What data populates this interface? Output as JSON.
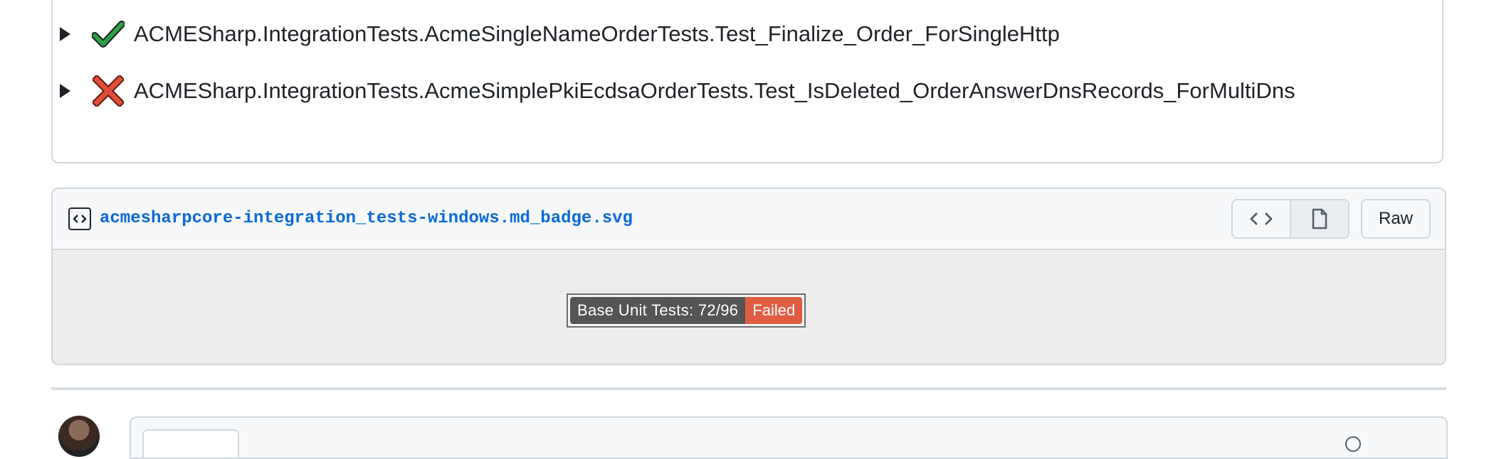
{
  "tests": [
    {
      "status": "passed",
      "name": "ACMESharp.IntegrationTests.AcmeSingleNameOrderTests.Test_Finalize_Order_ForSingleHttp"
    },
    {
      "status": "failed",
      "name": "ACMESharp.IntegrationTests.AcmeSimplePkiEcdsaOrderTests.Test_IsDeleted_OrderAnswerDnsRecords_ForMultiDns"
    }
  ],
  "file": {
    "name": "acmesharpcore-integration_tests-windows.md_badge.svg",
    "icon": "file-code-icon",
    "view_buttons": [
      "code-view-icon",
      "file-preview-icon"
    ],
    "raw_label": "Raw"
  },
  "badge": {
    "label": "Base Unit Tests: 72/96",
    "status": "Failed",
    "label_color": "#555555",
    "status_color": "#e05d44"
  },
  "colors": {
    "link": "#0969da",
    "pass_check": "#2ea043",
    "fail_x": "#e04e39",
    "border": "#d0d7de"
  }
}
